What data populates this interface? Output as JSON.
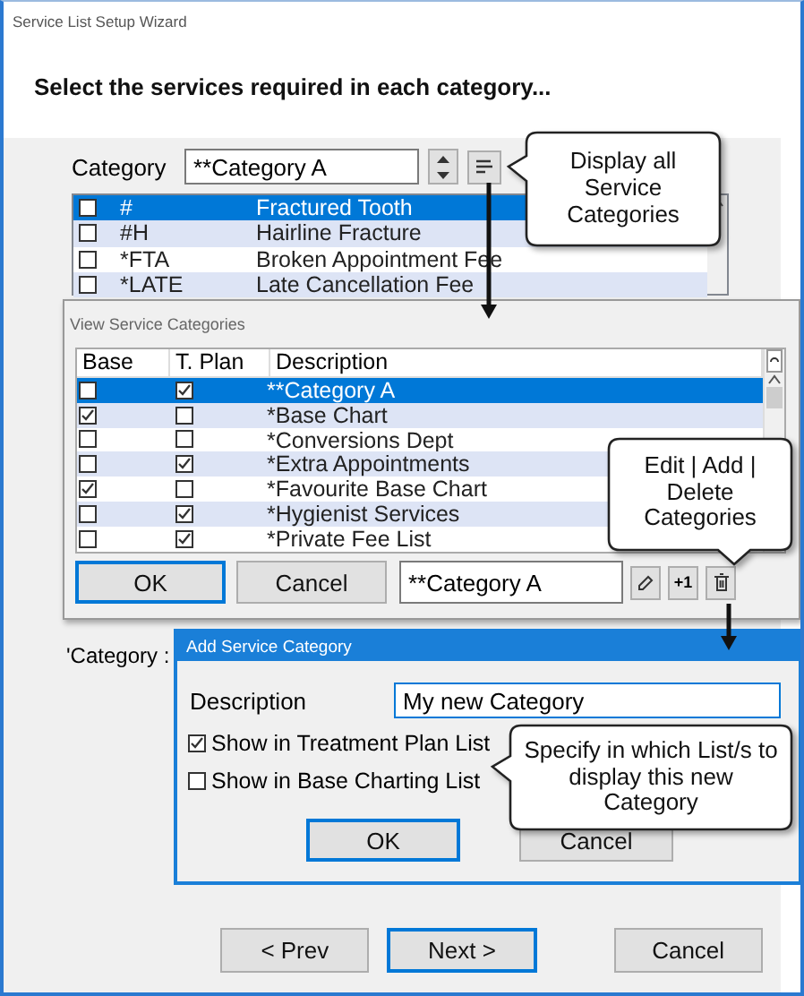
{
  "window": {
    "title": "Service List Setup Wizard"
  },
  "heading": "Select the services required in each category...",
  "category": {
    "label": "Category",
    "value": "**Category A"
  },
  "services": [
    {
      "checked": false,
      "code": "#",
      "description": "Fractured Tooth",
      "selected": true
    },
    {
      "checked": false,
      "code": "#H",
      "description": "Hairline Fracture",
      "selected": false
    },
    {
      "checked": false,
      "code": "*FTA",
      "description": "Broken Appointment Fee",
      "selected": false
    },
    {
      "checked": false,
      "code": "*LATE",
      "description": "Late Cancellation Fee",
      "selected": false
    }
  ],
  "hidden_label": "'Category :",
  "view_dialog": {
    "title": "View Service Categories",
    "columns": [
      "Base",
      "T. Plan",
      "Description"
    ],
    "rows": [
      {
        "base": false,
        "t_plan": true,
        "description": "**Category A",
        "selected": true
      },
      {
        "base": true,
        "t_plan": false,
        "description": "*Base Chart",
        "selected": false
      },
      {
        "base": false,
        "t_plan": false,
        "description": "*Conversions Dept",
        "selected": false
      },
      {
        "base": false,
        "t_plan": true,
        "description": "*Extra Appointments",
        "selected": false
      },
      {
        "base": true,
        "t_plan": false,
        "description": "*Favourite Base Chart",
        "selected": false
      },
      {
        "base": false,
        "t_plan": true,
        "description": "*Hygienist Services",
        "selected": false
      },
      {
        "base": false,
        "t_plan": true,
        "description": "*Private Fee List",
        "selected": false
      }
    ],
    "buttons": [
      {
        "label": "OK",
        "default": true
      },
      {
        "label": "Cancel",
        "default": false
      }
    ],
    "field_value": "**Category A",
    "add_label": "+1"
  },
  "add_dialog": {
    "title": "Add Service Category",
    "description_label": "Description",
    "description_value": "My new Category",
    "options": [
      {
        "label": "Show in Treatment Plan List",
        "checked": true
      },
      {
        "label": "Show in Base Charting List",
        "checked": false
      }
    ],
    "buttons": [
      {
        "label": "OK",
        "default": true
      },
      {
        "label": "Cancel",
        "default": false
      }
    ]
  },
  "callouts": [
    {
      "kind": "left",
      "text": "Display all Service Categories"
    },
    {
      "kind": "down",
      "text": "Edit | Add | Delete Categories"
    },
    {
      "kind": "left",
      "text": "Specify in which List/s to display this new Category"
    }
  ],
  "nav_buttons": [
    {
      "label": "< Prev",
      "default": false
    },
    {
      "label": "Next >",
      "default": true
    },
    {
      "label": "Cancel",
      "default": false
    }
  ]
}
